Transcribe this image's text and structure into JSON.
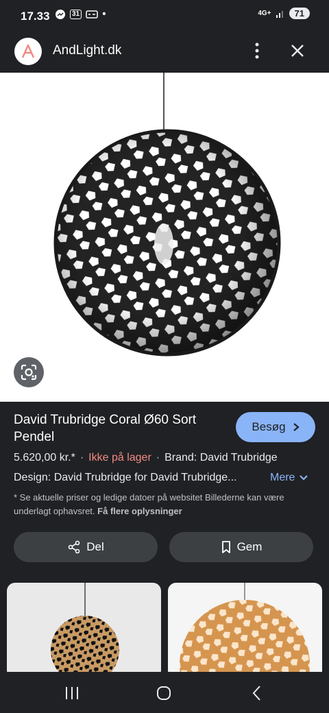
{
  "status_bar": {
    "time": "17.33",
    "calendar_day": "31",
    "network": "4G+",
    "battery": "71"
  },
  "site": {
    "name": "AndLight.dk",
    "logo_letter": "A"
  },
  "product": {
    "title": "David Trubridge Coral Ø60 Sort Pendel",
    "visit_label": "Besøg",
    "price": "5.620,00 kr.*",
    "stock": "Ikke på lager",
    "brand": "Brand: David Trubridge",
    "design": "Design: David Trubridge for David Trubridge...",
    "more_label": "Mere",
    "note": "* Se aktuelle priser og ledige datoer på websitet Billederne kan være underlagt ophavsret.",
    "note_link": "Få flere oplysninger"
  },
  "actions": {
    "share_label": "Del",
    "save_label": "Gem"
  },
  "colors": {
    "background": "#202124",
    "accent": "#8ab4f8",
    "stock_warning": "#f28b82",
    "logo_letter": "#f28b82"
  }
}
